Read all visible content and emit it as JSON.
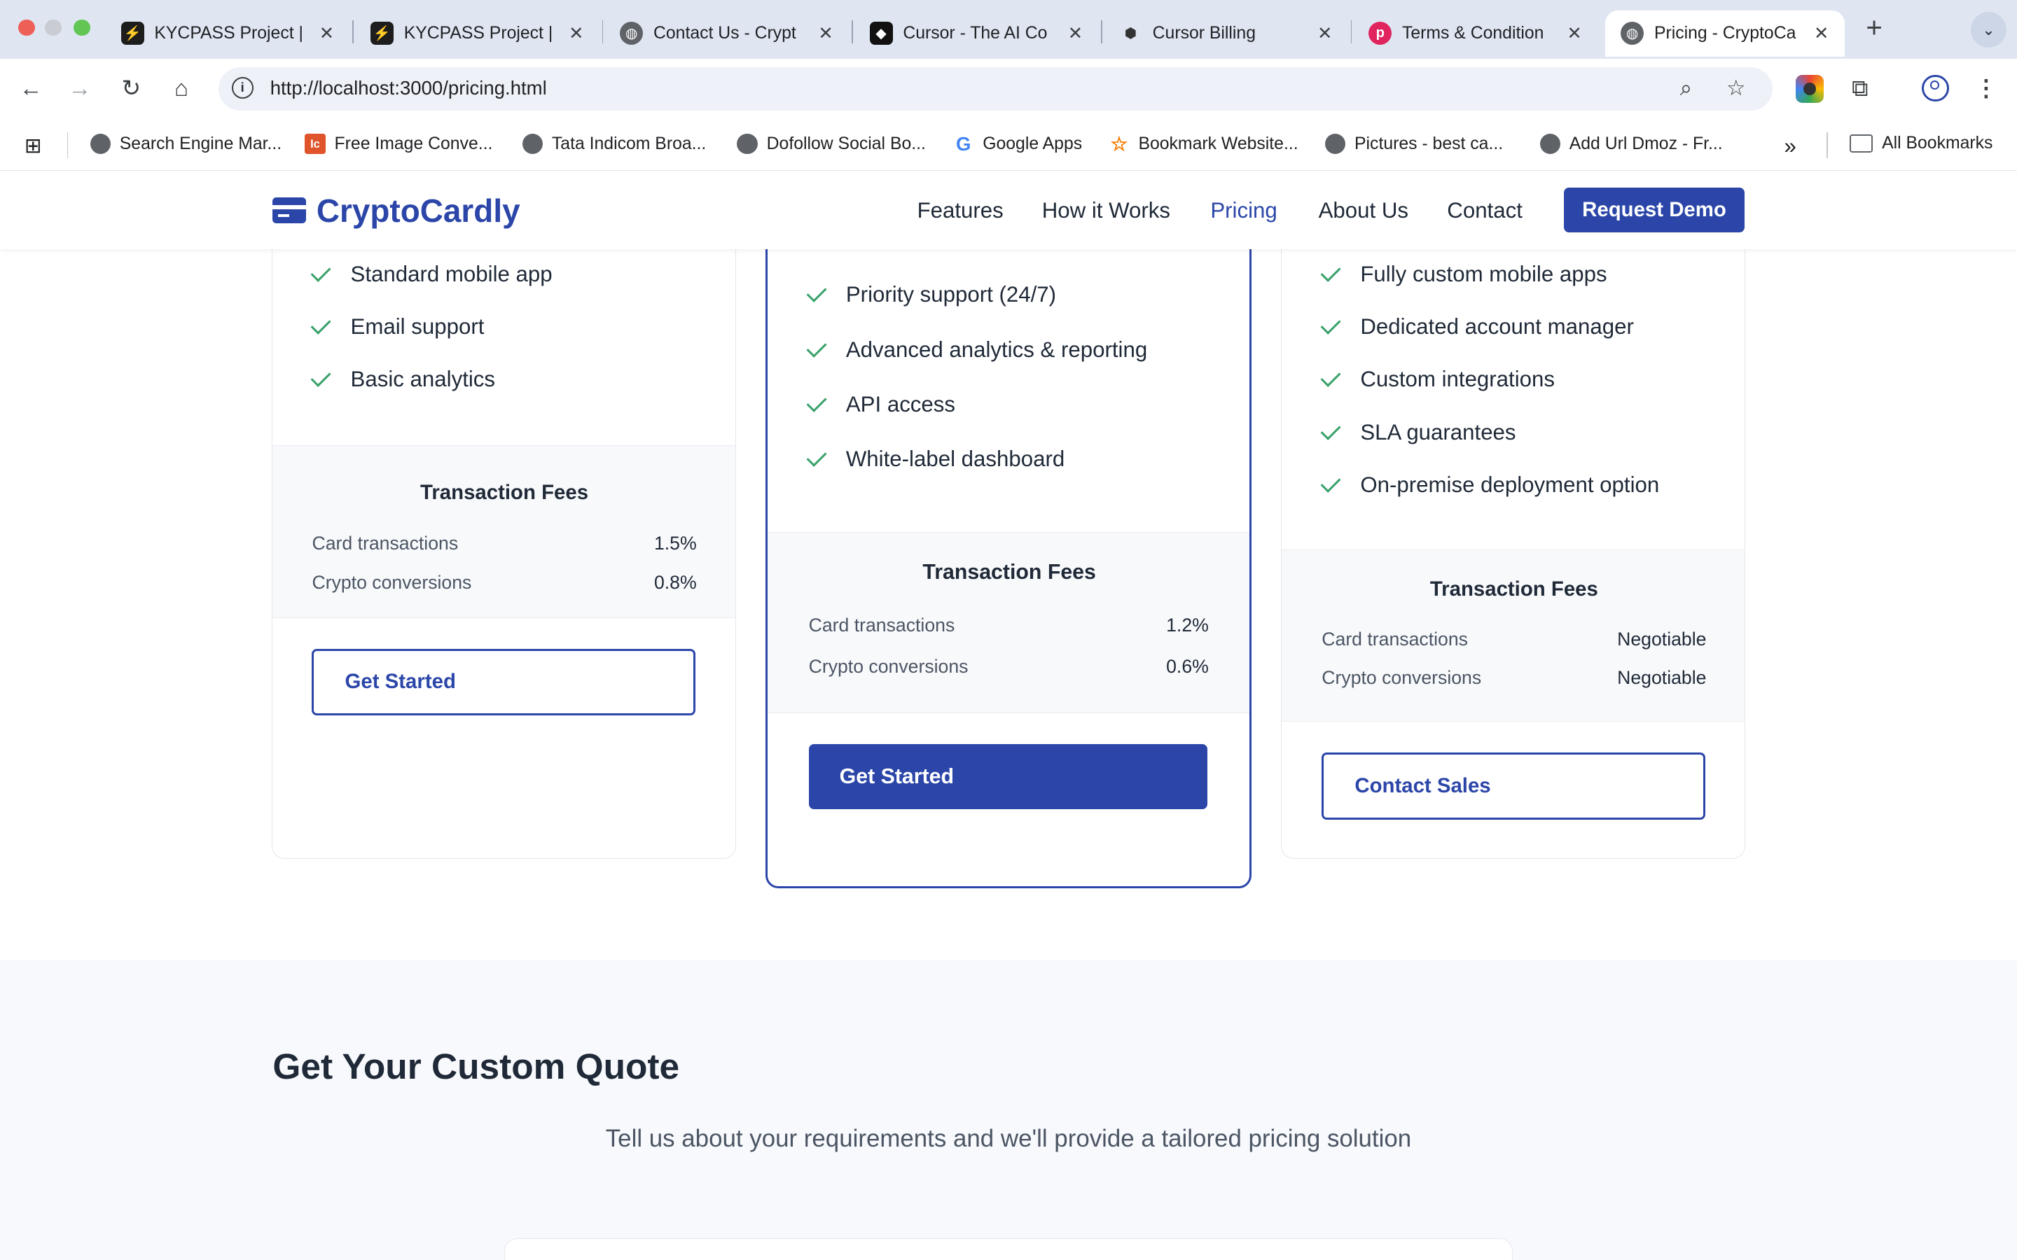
{
  "browser": {
    "tabs": [
      {
        "title": "KYCPASS Project |",
        "icon": "bolt-icon"
      },
      {
        "title": "KYCPASS Project |",
        "icon": "bolt-icon"
      },
      {
        "title": "Contact Us - Crypt",
        "icon": "globe-icon"
      },
      {
        "title": "Cursor - The AI Co",
        "icon": "cursor-icon"
      },
      {
        "title": "Cursor Billing",
        "icon": "cube-icon"
      },
      {
        "title": "Terms & Condition",
        "icon": "p-icon"
      },
      {
        "title": "Pricing - CryptoCa",
        "icon": "globe-icon"
      }
    ],
    "url": "http://localhost:3000/pricing.html",
    "bookmarks": [
      {
        "label": "Search Engine Mar...",
        "icon": "globe-icon"
      },
      {
        "label": "Free Image Conve...",
        "icon": "ic-icon"
      },
      {
        "label": "Tata Indicom Broa...",
        "icon": "globe-icon"
      },
      {
        "label": "Dofollow Social Bo...",
        "icon": "globe-icon"
      },
      {
        "label": "Google Apps",
        "icon": "google-icon"
      },
      {
        "label": "Bookmark Website...",
        "icon": "star-icon"
      },
      {
        "label": "Pictures - best ca...",
        "icon": "globe-icon"
      },
      {
        "label": "Add Url Dmoz - Fr...",
        "icon": "globe-icon"
      }
    ],
    "all_bookmarks": "All Bookmarks",
    "overflow": "»"
  },
  "site": {
    "brand": "CryptoCardly",
    "nav": [
      "Features",
      "How it Works",
      "Pricing",
      "About Us",
      "Contact"
    ],
    "active_nav": "Pricing",
    "cta": "Request Demo",
    "accent": "#2b46a8"
  },
  "plans": [
    {
      "features": [
        "Standard mobile app",
        "Email support",
        "Basic analytics"
      ],
      "fees_title": "Transaction Fees",
      "fees": [
        {
          "label": "Card transactions",
          "value": "1.5%"
        },
        {
          "label": "Crypto conversions",
          "value": "0.8%"
        }
      ],
      "button": "Get Started"
    },
    {
      "features": [
        "Priority support (24/7)",
        "Advanced analytics & reporting",
        "API access",
        "White-label dashboard"
      ],
      "fees_title": "Transaction Fees",
      "fees": [
        {
          "label": "Card transactions",
          "value": "1.2%"
        },
        {
          "label": "Crypto conversions",
          "value": "0.6%"
        }
      ],
      "button": "Get Started"
    },
    {
      "features": [
        "Fully custom mobile apps",
        "Dedicated account manager",
        "Custom integrations",
        "SLA guarantees",
        "On-premise deployment option"
      ],
      "fees_title": "Transaction Fees",
      "fees": [
        {
          "label": "Card transactions",
          "value": "Negotiable"
        },
        {
          "label": "Crypto conversions",
          "value": "Negotiable"
        }
      ],
      "button": "Contact Sales"
    }
  ],
  "quote": {
    "title": "Get Your Custom Quote",
    "subtitle": "Tell us about your requirements and we'll provide a tailored pricing solution"
  }
}
